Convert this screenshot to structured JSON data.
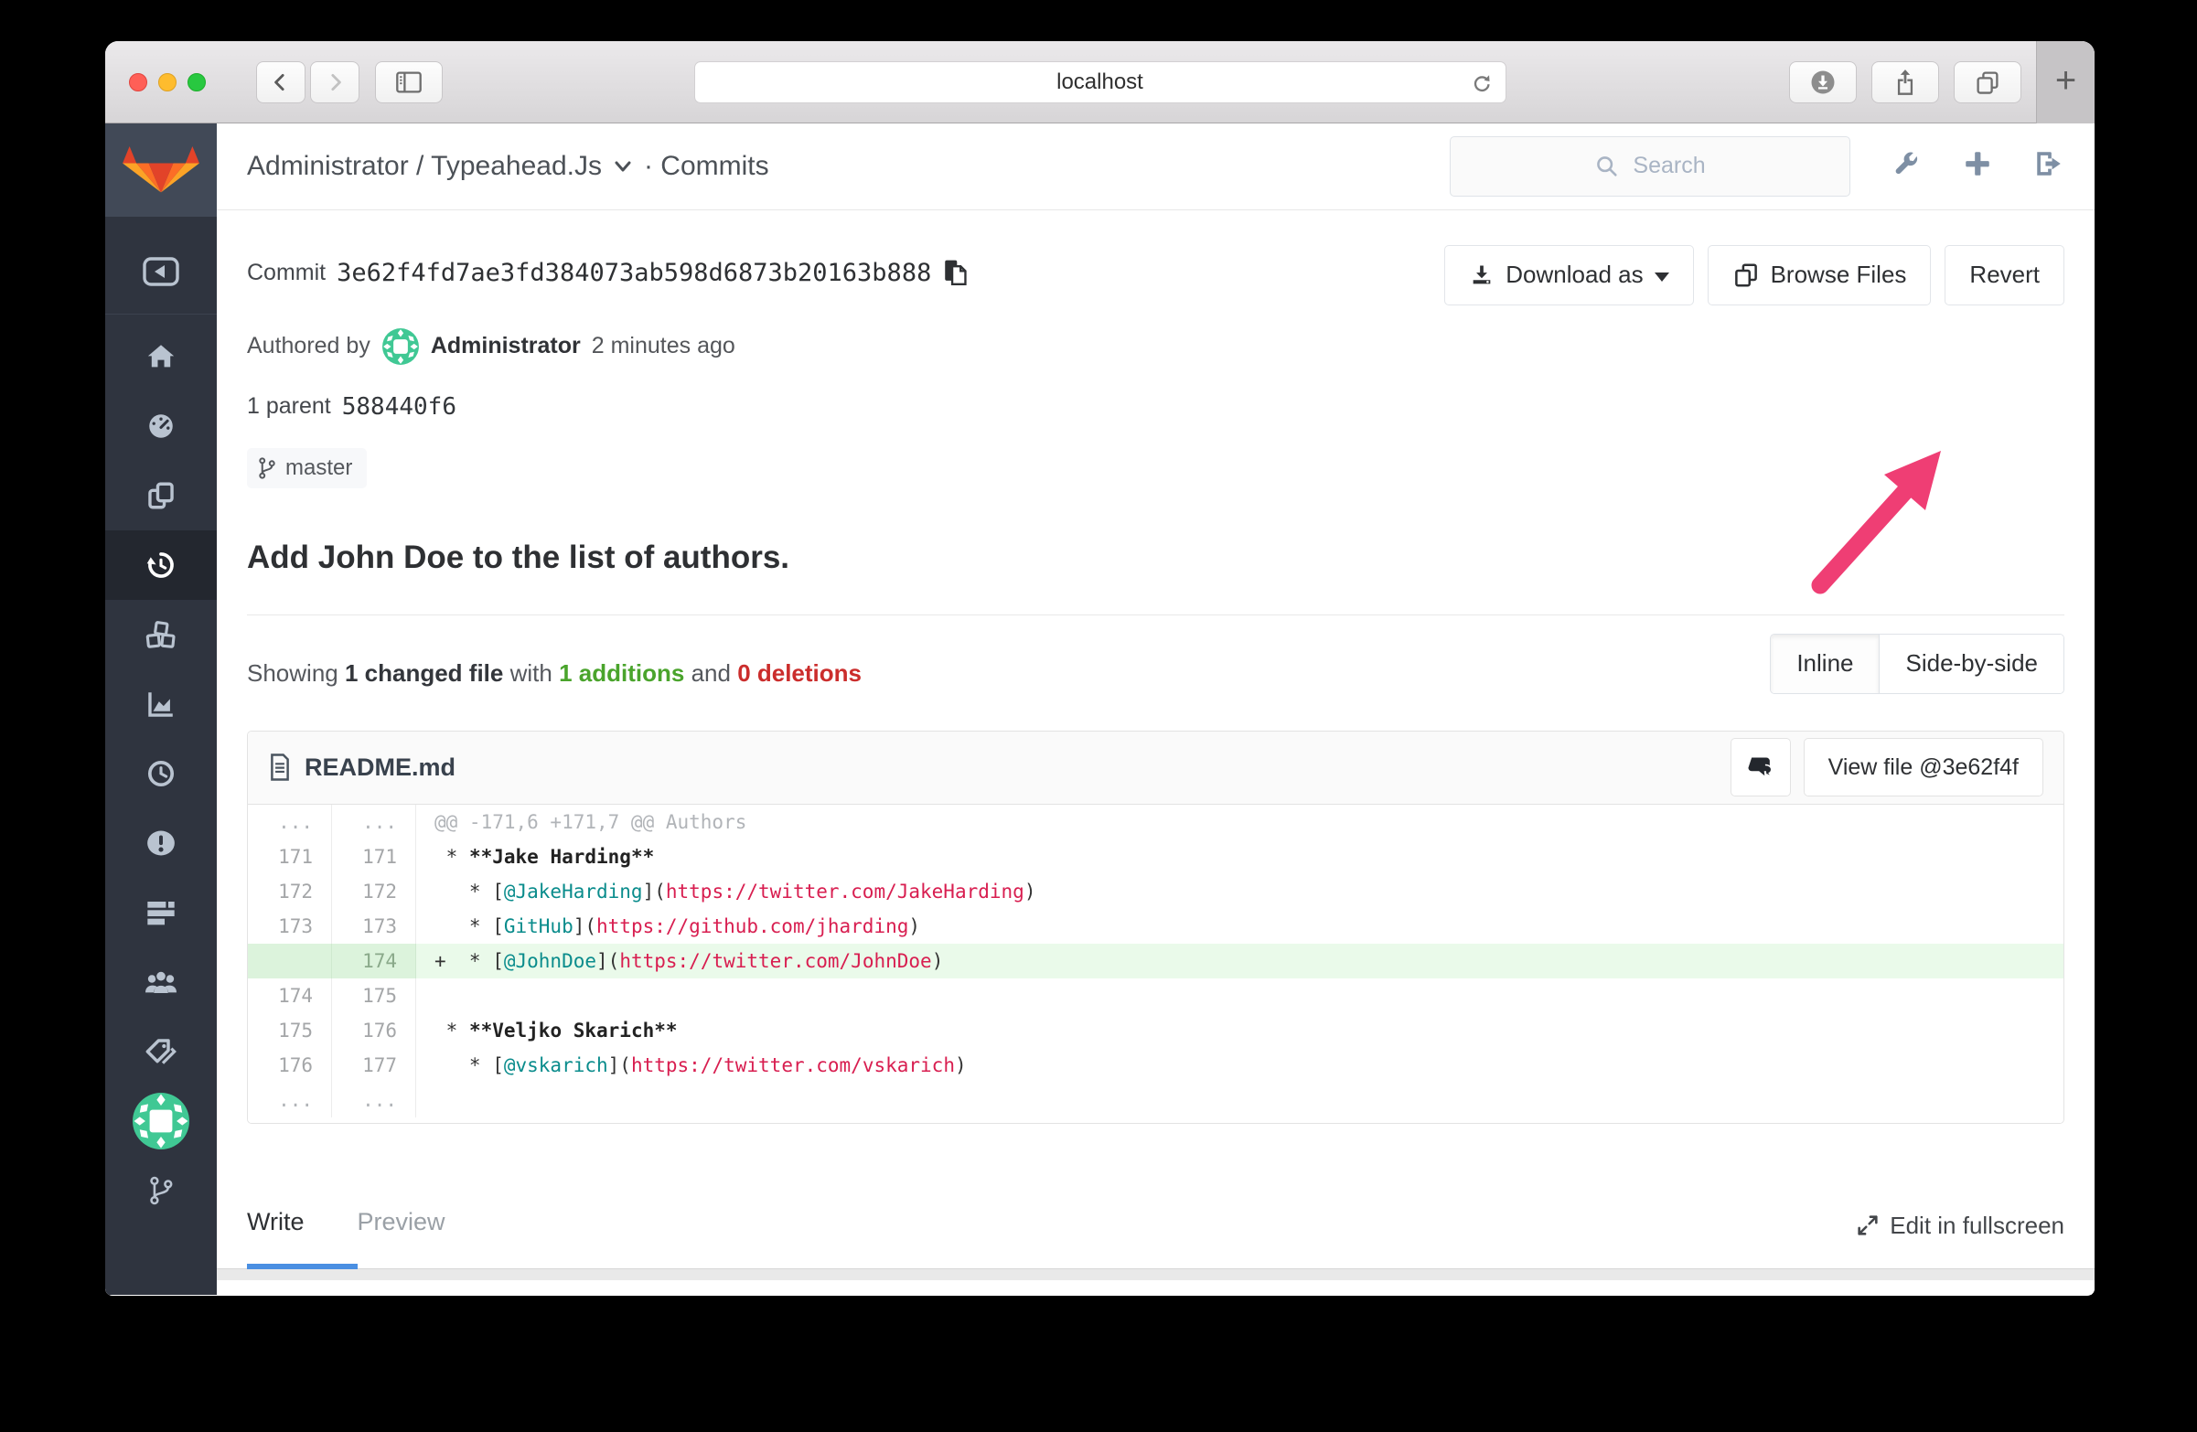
{
  "browser": {
    "url": "localhost",
    "icons": [
      "close-icon",
      "minimize-icon",
      "zoom-icon",
      "back-icon",
      "forward-icon",
      "sidebar-toggle-icon",
      "reload-icon",
      "downloads-icon",
      "share-icon",
      "tab-overview-icon",
      "new-tab-icon"
    ]
  },
  "sidebar": {
    "items": [
      "gitlab-logo",
      "collapse",
      "home",
      "dashboard",
      "projects",
      "history",
      "packages",
      "analytics",
      "time",
      "issues",
      "merge-requests",
      "members",
      "labels",
      "avatar",
      "branches"
    ]
  },
  "header": {
    "title": "Administrator / Typeahead.Js",
    "suffix": "· Commits",
    "search_placeholder": "Search",
    "icons": [
      "wrench-icon",
      "plus-icon",
      "sign-out-icon"
    ]
  },
  "commit": {
    "label": "Commit",
    "sha": "3e62f4fd7ae3fd384073ab598d6873b20163b888",
    "authored_prefix": "Authored by",
    "author": "Administrator",
    "time_ago": "2 minutes ago",
    "parent_label": "1 parent",
    "parent_sha": "588440f6",
    "branch": "master",
    "title": "Add John Doe to the list of authors."
  },
  "actions": {
    "download": "Download as",
    "browse": "Browse Files",
    "revert": "Revert",
    "arrow_color": "#ef3e74"
  },
  "stats": {
    "prefix": "Showing",
    "changed": "1 changed file",
    "with": "with",
    "additions": "1 additions",
    "and": "and",
    "deletions": "0 deletions"
  },
  "view_toggle": {
    "inline": "Inline",
    "side": "Side-by-side"
  },
  "diff": {
    "filename": "README.md",
    "view_file": "View file @3e62f4f",
    "colors": {
      "link": "#0a8c8c",
      "url": "#d81e50",
      "add_bg": "#eafaea"
    },
    "rows": [
      {
        "old": "...",
        "new": "...",
        "type": "match",
        "segments": [
          {
            "c": "m",
            "t": "@@ -171,6 +171,7 @@ Authors"
          }
        ]
      },
      {
        "old": "171",
        "new": "171",
        "type": "context",
        "segments": [
          {
            "c": "p",
            "t": " * "
          },
          {
            "c": "b",
            "t": "**Jake Harding**"
          }
        ]
      },
      {
        "old": "172",
        "new": "172",
        "type": "context",
        "segments": [
          {
            "c": "p",
            "t": "   * ["
          },
          {
            "c": "t",
            "t": "@JakeHarding"
          },
          {
            "c": "p",
            "t": "]("
          },
          {
            "c": "u",
            "t": "https://twitter.com/JakeHarding"
          },
          {
            "c": "p",
            "t": ")"
          }
        ]
      },
      {
        "old": "173",
        "new": "173",
        "type": "context",
        "segments": [
          {
            "c": "p",
            "t": "   * ["
          },
          {
            "c": "t",
            "t": "GitHub"
          },
          {
            "c": "p",
            "t": "]("
          },
          {
            "c": "u",
            "t": "https://github.com/jharding"
          },
          {
            "c": "p",
            "t": ")"
          }
        ]
      },
      {
        "old": "",
        "new": "174",
        "type": "add",
        "segments": [
          {
            "c": "p",
            "t": "+  * ["
          },
          {
            "c": "t",
            "t": "@JohnDoe"
          },
          {
            "c": "p",
            "t": "]("
          },
          {
            "c": "u",
            "t": "https://twitter.com/JohnDoe"
          },
          {
            "c": "p",
            "t": ")"
          }
        ]
      },
      {
        "old": "174",
        "new": "175",
        "type": "context",
        "segments": []
      },
      {
        "old": "175",
        "new": "176",
        "type": "context",
        "segments": [
          {
            "c": "p",
            "t": " * "
          },
          {
            "c": "b",
            "t": "**Veljko Skarich**"
          }
        ]
      },
      {
        "old": "176",
        "new": "177",
        "type": "context",
        "segments": [
          {
            "c": "p",
            "t": "   * ["
          },
          {
            "c": "t",
            "t": "@vskarich"
          },
          {
            "c": "p",
            "t": "]("
          },
          {
            "c": "u",
            "t": "https://twitter.com/vskarich"
          },
          {
            "c": "p",
            "t": ")"
          }
        ]
      },
      {
        "old": "...",
        "new": "...",
        "type": "match",
        "segments": []
      }
    ]
  },
  "editor": {
    "write": "Write",
    "preview": "Preview",
    "fullscreen": "Edit in fullscreen"
  }
}
